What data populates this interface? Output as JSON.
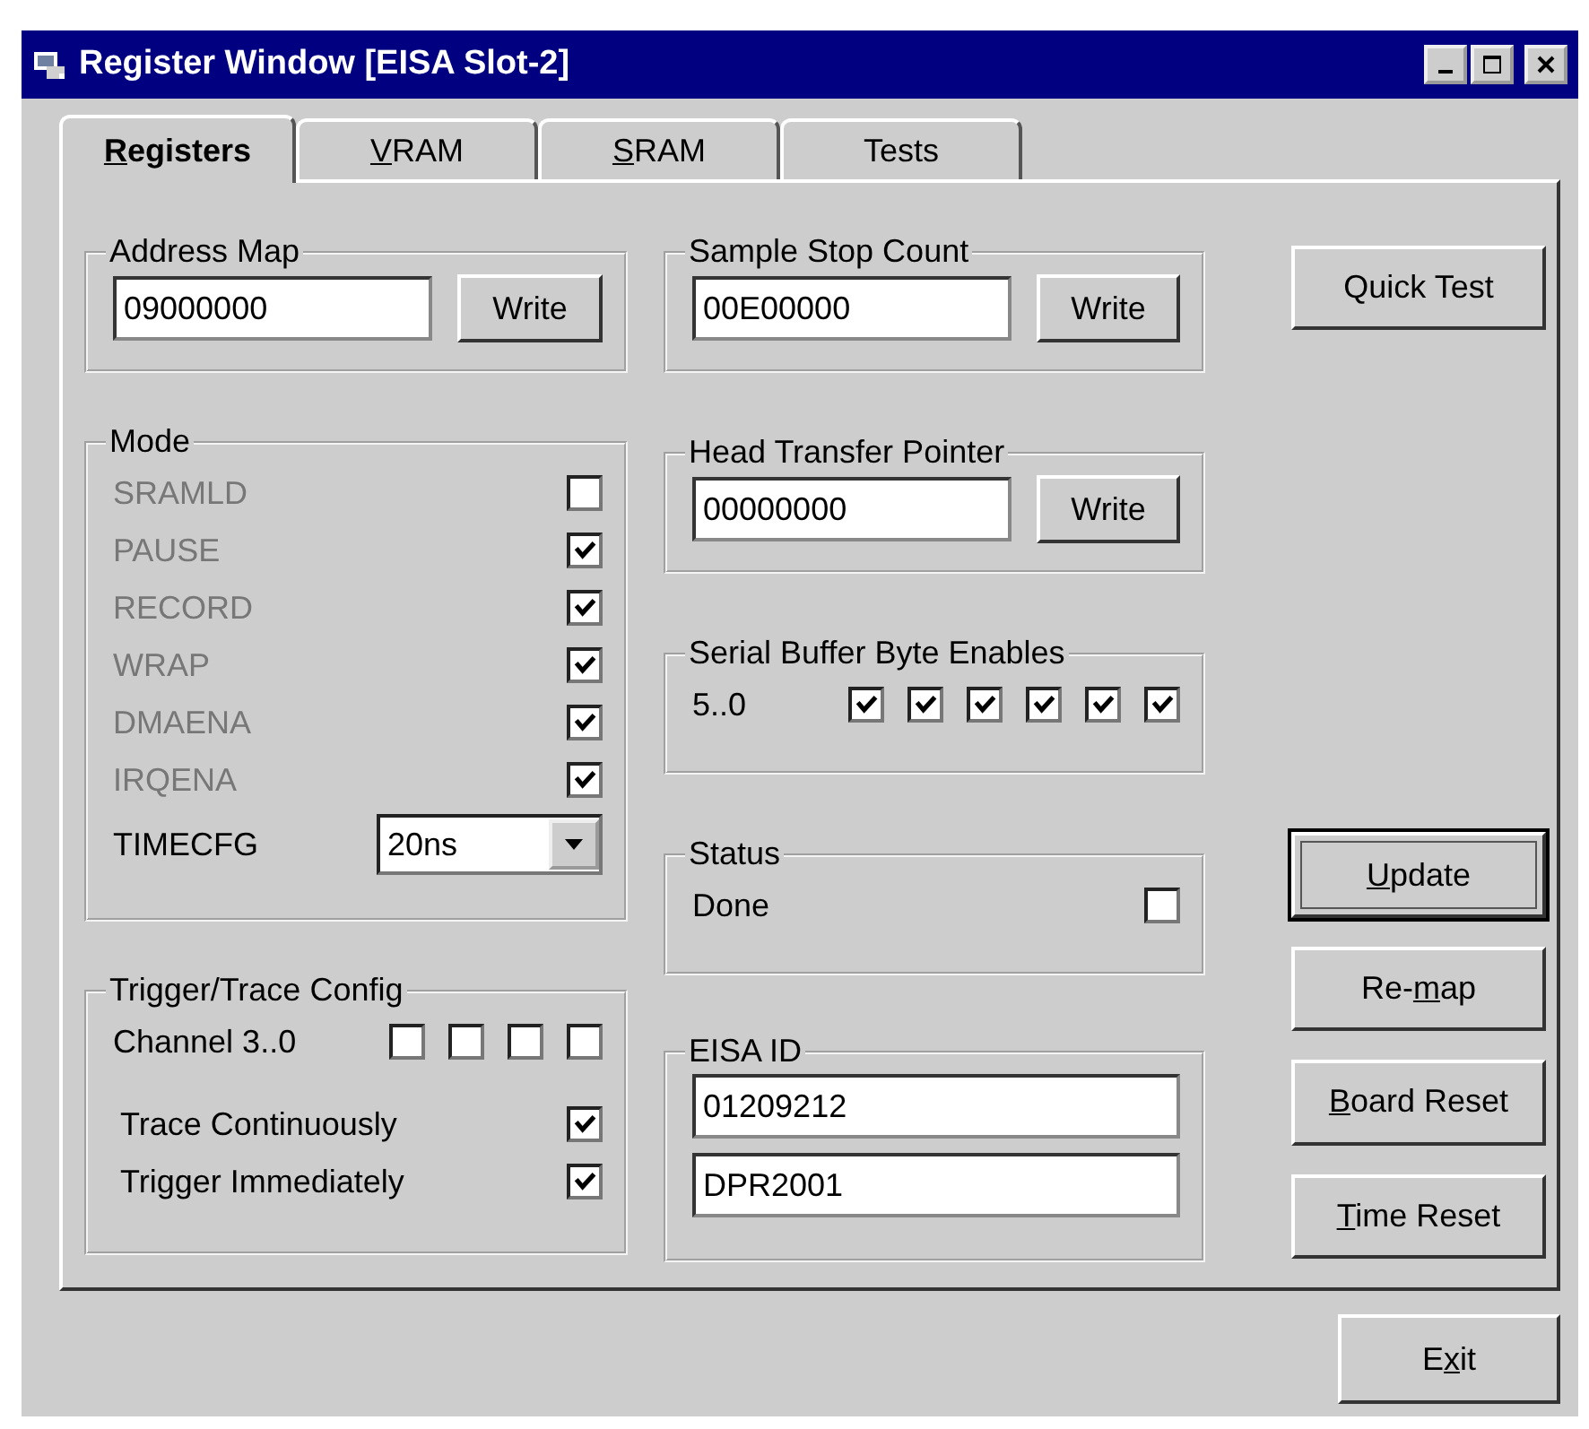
{
  "window": {
    "title": "Register Window [EISA Slot-2]"
  },
  "tabs": [
    {
      "key": "R",
      "post": "egisters",
      "selected": true
    },
    {
      "key": "V",
      "post": "RAM",
      "selected": false
    },
    {
      "key": "S",
      "post": "RAM",
      "selected": false
    },
    {
      "pre": "Tests",
      "selected": false
    }
  ],
  "address_map": {
    "title": "Address Map",
    "value": "09000000",
    "button": "Write"
  },
  "mode": {
    "title": "Mode",
    "items": [
      {
        "label": "SRAMLD",
        "checked": false,
        "disabled": true
      },
      {
        "label": "PAUSE",
        "checked": true,
        "disabled": true
      },
      {
        "label": "RECORD",
        "checked": true,
        "disabled": true
      },
      {
        "label": "WRAP",
        "checked": true,
        "disabled": true
      },
      {
        "label": "DMAENA",
        "checked": true,
        "disabled": true
      },
      {
        "label": "IRQENA",
        "checked": true,
        "disabled": true
      }
    ],
    "timecfg": {
      "label": "TIMECFG",
      "value": "20ns"
    }
  },
  "trigger": {
    "title": "Trigger/Trace Config",
    "channel_label": "Channel 3..0",
    "channels": [
      {
        "checked": false
      },
      {
        "checked": false
      },
      {
        "checked": false
      },
      {
        "checked": false
      }
    ],
    "options": [
      {
        "label": "Trace Continuously",
        "checked": true
      },
      {
        "label": "Trigger Immediately",
        "checked": true
      }
    ]
  },
  "sample_stop_count": {
    "title": "Sample Stop Count",
    "value": "00E00000",
    "button": "Write"
  },
  "head_transfer_pointer": {
    "title": "Head Transfer Pointer",
    "value": "00000000",
    "button": "Write"
  },
  "serial_buffer": {
    "title": "Serial Buffer Byte Enables",
    "label": "5..0",
    "bytes": [
      {
        "checked": true
      },
      {
        "checked": true
      },
      {
        "checked": true
      },
      {
        "checked": true
      },
      {
        "checked": true
      },
      {
        "checked": true
      }
    ]
  },
  "status": {
    "title": "Status",
    "label": "Done",
    "checked": false
  },
  "eisa_id": {
    "title": "EISA ID",
    "values": [
      "01209212",
      "DPR2001"
    ]
  },
  "quick_test": {
    "pre": "Quick Test",
    "focused": false
  },
  "actions": [
    {
      "key": "U",
      "post": "pdate",
      "focused": true
    },
    {
      "pre": "Re-",
      "key": "m",
      "post": "ap",
      "focused": false
    },
    {
      "key": "B",
      "post": "oard Reset",
      "focused": false
    },
    {
      "key": "T",
      "post": "ime Reset",
      "focused": false
    }
  ],
  "exit": {
    "pre": "E",
    "key": "x",
    "post": "it",
    "focused": false
  }
}
